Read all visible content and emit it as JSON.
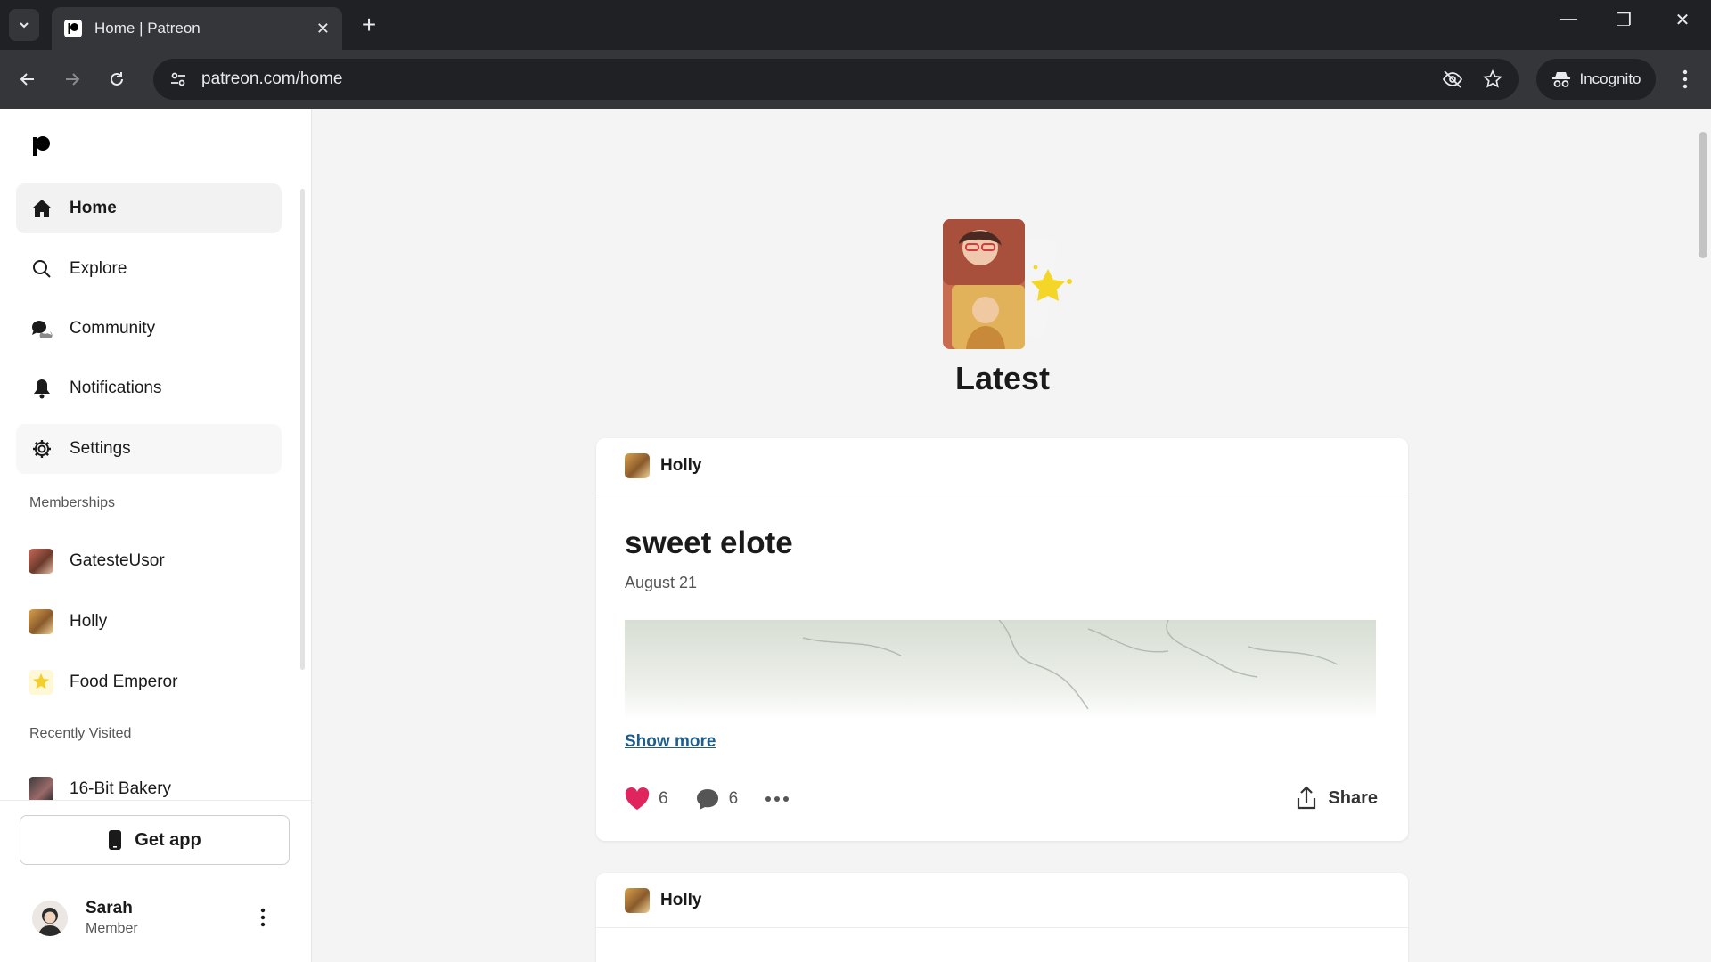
{
  "browser": {
    "tab_title": "Home | Patreon",
    "url": "patreon.com/home",
    "incognito_label": "Incognito"
  },
  "sidebar": {
    "nav": [
      {
        "label": "Home",
        "icon": "home-icon"
      },
      {
        "label": "Explore",
        "icon": "search-icon"
      },
      {
        "label": "Community",
        "icon": "chat-bubbles-icon"
      },
      {
        "label": "Notifications",
        "icon": "bell-icon"
      },
      {
        "label": "Settings",
        "icon": "gear-icon"
      }
    ],
    "memberships_label": "Memberships",
    "memberships": [
      {
        "label": "GatesteUsor"
      },
      {
        "label": "Holly"
      },
      {
        "label": "Food Emperor"
      }
    ],
    "recently_visited_label": "Recently Visited",
    "recent": [
      {
        "label": "16-Bit Bakery"
      }
    ],
    "get_app_label": "Get app",
    "user": {
      "name": "Sarah",
      "role": "Member"
    }
  },
  "main": {
    "heading": "Latest",
    "posts": [
      {
        "creator": "Holly",
        "title": "sweet elote",
        "date": "August 21",
        "show_more": "Show more",
        "likes": "6",
        "comments": "6",
        "share_label": "Share"
      },
      {
        "creator": "Holly"
      }
    ]
  },
  "colors": {
    "accent_like": "#e0245e",
    "link": "#1f5e8c"
  }
}
